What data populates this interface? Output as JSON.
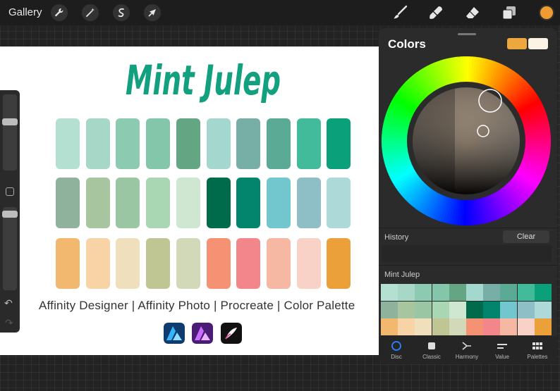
{
  "topbar": {
    "gallery_label": "Gallery",
    "left_icons": [
      "wrench-icon",
      "magic-wand-icon",
      "selection-icon",
      "transform-arrow-icon"
    ],
    "right_tools": [
      "brush-icon",
      "smudge-icon",
      "eraser-icon",
      "layers-icon"
    ],
    "current_color": "#ee9c32"
  },
  "canvas": {
    "title": "Mint Julep",
    "title_color": "#12a07f",
    "apps_text": "Affinity Designer | Affinity Photo | Procreate | Color Palette",
    "app_logos": [
      "affinity-designer-logo",
      "affinity-photo-logo",
      "procreate-logo"
    ],
    "swatch_rows": [
      [
        "#b4e0d1",
        "#a7d7c6",
        "#8ccab2",
        "#84c6a9",
        "#64a684",
        "#a4d8ce",
        "#77afa6",
        "#5aaa96",
        "#42bb9a",
        "#0aa07a"
      ],
      [
        "#8eb29c",
        "#a7c59e",
        "#9ac6a4",
        "#a9d7b3",
        "#cfe6d1",
        "#006b4b",
        "#03846c",
        "#72c7ce",
        "#8ebec6",
        "#addad8"
      ],
      [
        "#f3b870",
        "#f8d3a5",
        "#efdfbc",
        "#bfc693",
        "#d2d9b9",
        "#f59274",
        "#f3868a",
        "#f6b8a3",
        "#f8d1c7",
        "#eca03a"
      ]
    ]
  },
  "sidebar": {
    "undo_glyph": "↶",
    "redo_glyph": "↷",
    "brush_size_level": 0.65,
    "opacity_level": 0.95
  },
  "colors_panel": {
    "title": "Colors",
    "primary_color": "#eea63e",
    "secondary_color": "#fbf3e3",
    "history_label": "History",
    "clear_label": "Clear",
    "palette_label": "Mint Julep",
    "tabs": [
      {
        "label": "Disc",
        "icon": "disc-icon",
        "active": true
      },
      {
        "label": "Classic",
        "icon": "classic-icon",
        "active": false
      },
      {
        "label": "Harmony",
        "icon": "harmony-icon",
        "active": false
      },
      {
        "label": "Value",
        "icon": "value-icon",
        "active": false
      },
      {
        "label": "Palettes",
        "icon": "palettes-icon",
        "active": false
      }
    ]
  }
}
